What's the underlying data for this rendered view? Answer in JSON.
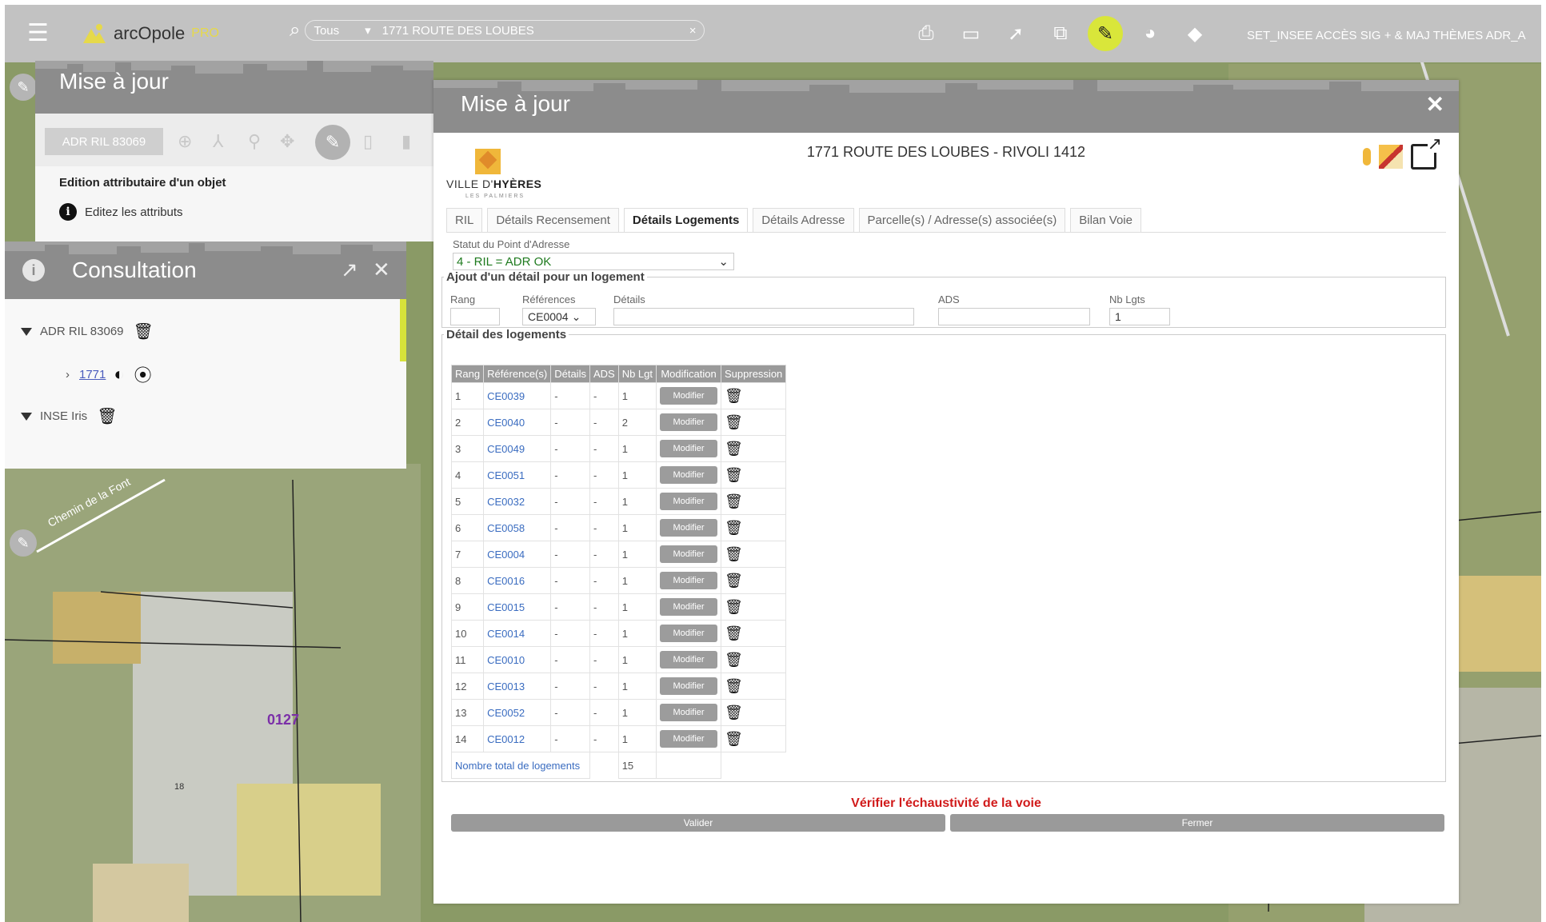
{
  "topbar": {
    "app_name": "arcOpole",
    "app_suffix": "PRO",
    "search_scope": "Tous",
    "search_value": "1771 ROUTE DES LOUBES",
    "username": "SET_INSEE ACCÈS SIG + & MAJ THÈMES ADR_A"
  },
  "left_update_panel": {
    "title": "Mise à jour",
    "disabled_button": "ADR RIL 83069",
    "edit_title": "Edition attributaire d'un objet",
    "edit_hint": "Editez les attributs"
  },
  "consultation_panel": {
    "title": "Consultation",
    "layers": [
      {
        "label": "ADR RIL 83069",
        "child_link": "1771"
      },
      {
        "label": "INSE Iris"
      }
    ]
  },
  "map": {
    "road_label": "Chemin de la Font",
    "parcel_label": "0127",
    "small_label": "18"
  },
  "dialog": {
    "title": "Mise à jour",
    "address_title": "1771 ROUTE DES LOUBES - RIVOLI 1412",
    "city_logo": {
      "name_prefix": "VILLE D'",
      "name_main": "HYÈRES",
      "tag": "LES PALMIERS"
    },
    "tabs": [
      "RIL",
      "Détails Recensement",
      "Détails Logements",
      "Détails Adresse",
      "Parcelle(s) / Adresse(s) associée(s)",
      "Bilan Voie"
    ],
    "active_tab": "Détails Logements",
    "statut_label": "Statut du Point d'Adresse",
    "statut_value": "4 - RIL = ADR OK",
    "ajout": {
      "legend": "Ajout d'un détail pour un logement",
      "rang_label": "Rang",
      "references_label": "Références",
      "references_value": "CE0004",
      "details_label": "Détails",
      "ads_label": "ADS",
      "nb_lgts_label": "Nb Lgts",
      "nb_lgts_value": "1"
    },
    "detail": {
      "legend": "Détail des logements",
      "columns": [
        "Rang",
        "Référence(s)",
        "Détails",
        "ADS",
        "Nb Lgt",
        "Modification",
        "Suppression"
      ],
      "modify_label": "Modifier",
      "rows": [
        {
          "rang": "1",
          "ref": "CE0039",
          "details": "-",
          "ads": "-",
          "nb": "1"
        },
        {
          "rang": "2",
          "ref": "CE0040",
          "details": "-",
          "ads": "-",
          "nb": "2"
        },
        {
          "rang": "3",
          "ref": "CE0049",
          "details": "-",
          "ads": "-",
          "nb": "1"
        },
        {
          "rang": "4",
          "ref": "CE0051",
          "details": "-",
          "ads": "-",
          "nb": "1"
        },
        {
          "rang": "5",
          "ref": "CE0032",
          "details": "-",
          "ads": "-",
          "nb": "1"
        },
        {
          "rang": "6",
          "ref": "CE0058",
          "details": "-",
          "ads": "-",
          "nb": "1"
        },
        {
          "rang": "7",
          "ref": "CE0004",
          "details": "-",
          "ads": "-",
          "nb": "1"
        },
        {
          "rang": "8",
          "ref": "CE0016",
          "details": "-",
          "ads": "-",
          "nb": "1"
        },
        {
          "rang": "9",
          "ref": "CE0015",
          "details": "-",
          "ads": "-",
          "nb": "1"
        },
        {
          "rang": "10",
          "ref": "CE0014",
          "details": "-",
          "ads": "-",
          "nb": "1"
        },
        {
          "rang": "11",
          "ref": "CE0010",
          "details": "-",
          "ads": "-",
          "nb": "1"
        },
        {
          "rang": "12",
          "ref": "CE0013",
          "details": "-",
          "ads": "-",
          "nb": "1"
        },
        {
          "rang": "13",
          "ref": "CE0052",
          "details": "-",
          "ads": "-",
          "nb": "1"
        },
        {
          "rang": "14",
          "ref": "CE0012",
          "details": "-",
          "ads": "-",
          "nb": "1"
        }
      ],
      "total_label": "Nombre total de logements",
      "total_value": "15"
    },
    "verify_text": "Vérifier l'échaustivité de la voie",
    "validate_label": "Valider",
    "close_label": "Fermer"
  }
}
